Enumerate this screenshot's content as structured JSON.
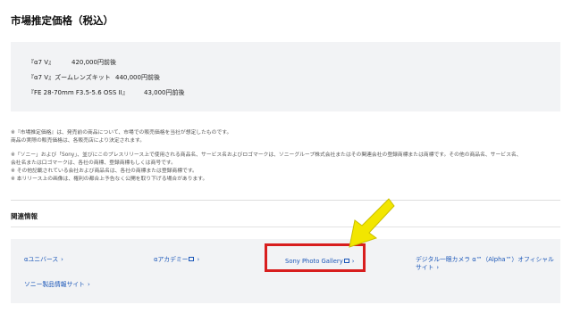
{
  "section_title": "市場推定価格（税込）",
  "prices": [
    {
      "name": "『α7 V』",
      "value": "420,000円前後"
    },
    {
      "name": "『α7 V』ズームレンズキット",
      "value": "440,000円前後"
    },
    {
      "name": "『FE 28-70mm F3.5-5.6 OSS II』",
      "value": "43,000円前後"
    }
  ],
  "notes": {
    "n1": "※『市場推定価格』は、発売前の商品について、市場での販売価格を当社が想定したものです。",
    "n2": "商品の実際の販売価格は、各販売店により決定されます。",
    "n3": "※「ソニー」および「Sony」、並びにこのプレスリリース上で使用される商品名、サービス名およびロゴマークは、ソニーグループ株式会社またはその関連会社の登録商標または商標です。その他の商品名、サービス名、",
    "n4": "会社名または口ゴマークは、各社の商標、登録商標もしくは商号です。",
    "n5": "※ その他記載されている会社および商品名は、各社の商標または登録商標です。",
    "n6": "※ 本リリース上の画像は、権利の都合上予告なく公開を取り下げる場合があります。"
  },
  "related": {
    "title": "関連情報",
    "links": {
      "universe": "αユニバース",
      "academy": "αアカデミー",
      "gallery": "Sony Photo Gallery",
      "official_line1": "デジタル一眼カメラ α™（Alpha™）オフィシャル",
      "official_line2": "サイト",
      "products": "ソニー製品情報サイト"
    },
    "chevron": "›"
  },
  "colors": {
    "link": "#1a56b8",
    "highlight": "#d81e1e",
    "arrow": "#f2e600",
    "panel": "#f2f3f5"
  },
  "icons": {
    "external_link": "external-link-icon",
    "chevron": "chevron-right-icon",
    "annotation_arrow": "arrow-icon"
  }
}
